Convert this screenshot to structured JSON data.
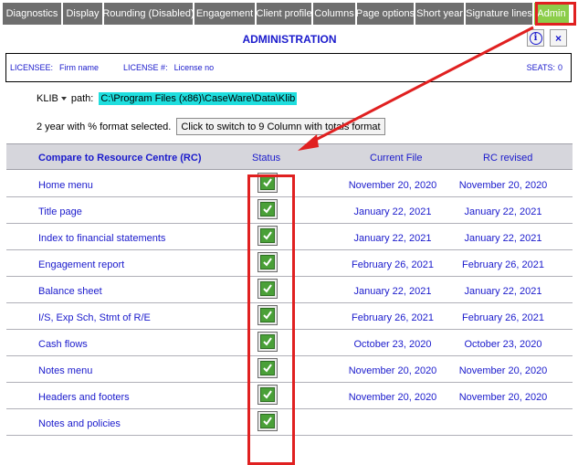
{
  "tabs": [
    {
      "label": "Diagnostics",
      "width": 64
    },
    {
      "label": "Display",
      "width": 43
    },
    {
      "label": "Rounding (Disabled)",
      "width": 97
    },
    {
      "label": "Engagement",
      "width": 66
    },
    {
      "label": "Client profile",
      "width": 60
    },
    {
      "label": "Columns",
      "width": 46
    },
    {
      "label": "Page options",
      "width": 62
    },
    {
      "label": "Short year",
      "width": 53
    },
    {
      "label": "Signature lines",
      "width": 73
    },
    {
      "label": "Admin",
      "width": 38
    }
  ],
  "header": {
    "title": "ADMINISTRATION",
    "info_icon": "i",
    "close_icon": "×"
  },
  "license": {
    "licensee_label": "LICENSEE:",
    "licensee_value": "Firm name",
    "license_no_label": "LICENSE #:",
    "license_no_value": "License no",
    "seats_label": "SEATS:",
    "seats_value": "0"
  },
  "klib": {
    "select_value": "KLIB",
    "path_label": "path:",
    "path_value": "C:\\Program Files (x86)\\CaseWare\\Data\\Klib"
  },
  "format": {
    "status_text": "2 year with % format selected.",
    "switch_button": "Click to switch to 9 Column with totals format"
  },
  "table": {
    "headers": {
      "name": "Compare to Resource Centre (RC)",
      "status": "Status",
      "current": "Current File",
      "rc": "RC revised"
    },
    "rows": [
      {
        "name": "Home menu",
        "current": "November 20, 2020",
        "rc": "November 20, 2020",
        "checked": true
      },
      {
        "name": "Title page",
        "current": "January 22, 2021",
        "rc": "January 22, 2021",
        "checked": true
      },
      {
        "name": "Index to financial statements",
        "current": "January 22, 2021",
        "rc": "January 22, 2021",
        "checked": true
      },
      {
        "name": "Engagement report",
        "current": "February 26, 2021",
        "rc": "February 26, 2021",
        "checked": true
      },
      {
        "name": "Balance sheet",
        "current": "January 22, 2021",
        "rc": "January 22, 2021",
        "checked": true
      },
      {
        "name": "I/S, Exp Sch, Stmt of R/E",
        "current": "February 26, 2021",
        "rc": "February 26, 2021",
        "checked": true
      },
      {
        "name": "Cash flows",
        "current": "October 23, 2020",
        "rc": "October 23, 2020",
        "checked": true
      },
      {
        "name": "Notes menu",
        "current": "November 20, 2020",
        "rc": "November 20, 2020",
        "checked": true
      },
      {
        "name": "Headers and footers",
        "current": "November 20, 2020",
        "rc": "November 20, 2020",
        "checked": true
      },
      {
        "name": "Notes and policies",
        "current": "",
        "rc": "",
        "checked": true
      }
    ]
  },
  "colors": {
    "tab_bg": "#6e6e6e",
    "tab_active": "#8ccd4a",
    "link_blue": "#1a1acc",
    "highlight": "#e02020",
    "check_green": "#4aa038",
    "path_bg": "#1fdede"
  }
}
